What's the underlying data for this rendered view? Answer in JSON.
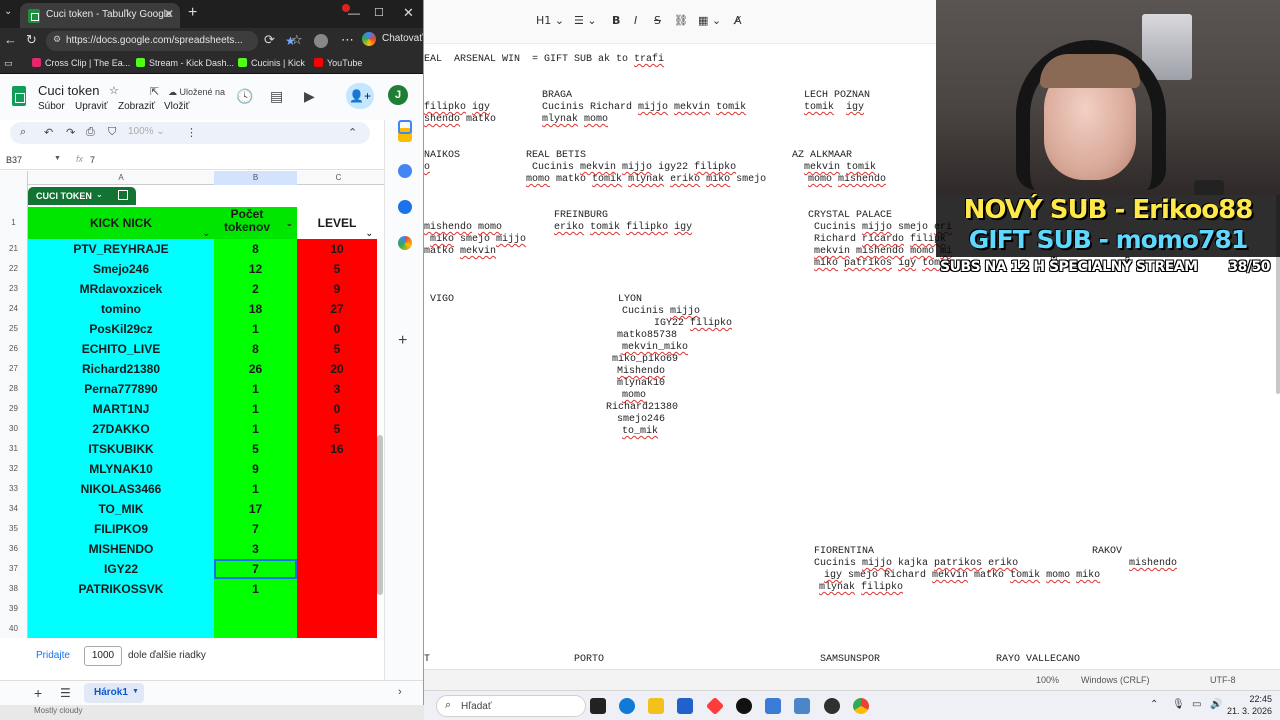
{
  "browser": {
    "tab_title": "Cuci token - Tabuľky Google",
    "url": "https://docs.google.com/spreadsheets...",
    "chat_label": "Chatovať",
    "bookmarks": [
      "Cross Clip | The Ea...",
      "Stream - Kick Dash...",
      "Cucinis | Kick",
      "YouTube"
    ]
  },
  "sheets": {
    "doc_title": "Cuci token",
    "saved_status": "Uložené na",
    "menu": [
      "Súbor",
      "Upraviť",
      "Zobraziť",
      "Vložiť"
    ],
    "avatar_letter": "J",
    "zoom": "100%",
    "cell_ref": "B37",
    "fx_label": "fx",
    "formula_value": "7",
    "columns": [
      "A",
      "B",
      "C"
    ],
    "table_chip": "CUCI TOKEN",
    "headers": {
      "row": "1",
      "a": "KICK NICK",
      "b": "Počet tokenov",
      "c": "LEVEL"
    },
    "rows": [
      {
        "n": "21",
        "nick": "PTV_REYHRAJE",
        "tokens": "8",
        "level": "10"
      },
      {
        "n": "22",
        "nick": "Smejo246",
        "tokens": "12",
        "level": "5"
      },
      {
        "n": "23",
        "nick": "MRdavoxzicek",
        "tokens": "2",
        "level": "9"
      },
      {
        "n": "24",
        "nick": "tomino",
        "tokens": "18",
        "level": "27"
      },
      {
        "n": "25",
        "nick": "PosKil29cz",
        "tokens": "1",
        "level": "0"
      },
      {
        "n": "26",
        "nick": "ECHITO_LIVE",
        "tokens": "8",
        "level": "5"
      },
      {
        "n": "27",
        "nick": "Richard21380",
        "tokens": "26",
        "level": "20"
      },
      {
        "n": "28",
        "nick": "Perna777890",
        "tokens": "1",
        "level": "3"
      },
      {
        "n": "29",
        "nick": "MART1NJ",
        "tokens": "1",
        "level": "0"
      },
      {
        "n": "30",
        "nick": "27DAKKO",
        "tokens": "1",
        "level": "5"
      },
      {
        "n": "31",
        "nick": "ITSKUBIKK",
        "tokens": "5",
        "level": "16"
      },
      {
        "n": "32",
        "nick": "MLYNAK10",
        "tokens": "9",
        "level": ""
      },
      {
        "n": "33",
        "nick": "NIKOLAS3466",
        "tokens": "1",
        "level": ""
      },
      {
        "n": "34",
        "nick": "TO_MIK",
        "tokens": "17",
        "level": ""
      },
      {
        "n": "35",
        "nick": "FILIPKO9",
        "tokens": "7",
        "level": ""
      },
      {
        "n": "36",
        "nick": "MISHENDO",
        "tokens": "3",
        "level": ""
      },
      {
        "n": "37",
        "nick": "IGY22",
        "tokens": "7",
        "level": ""
      },
      {
        "n": "38",
        "nick": "PATRIKOSSVK",
        "tokens": "1",
        "level": ""
      },
      {
        "n": "39",
        "nick": "",
        "tokens": "",
        "level": ""
      },
      {
        "n": "40",
        "nick": "",
        "tokens": "",
        "level": ""
      }
    ],
    "add_rows_button": "Pridajte",
    "add_rows_value": "1000",
    "add_rows_label": "dole ďalšie riadky",
    "sheet_tab": "Hárok1"
  },
  "editor": {
    "heading_label": "H1",
    "status_zoom": "100%",
    "status_eol": "Windows (CRLF)",
    "status_enc": "UTF-8"
  },
  "overlay": {
    "sub_line1": "NOVÝ SUB - Erikoo88",
    "sub_line2": "GIFT SUB - momo781",
    "goal_label": "SUBS NA 12 H ŠPECIALNÝ STREAM",
    "goal_count": "38/50"
  },
  "taskbar": {
    "search_placeholder": "Hľadať",
    "time": "22:45",
    "date": "21. 3. 2026"
  },
  "underlying_window_text": "Mostly cloudy"
}
